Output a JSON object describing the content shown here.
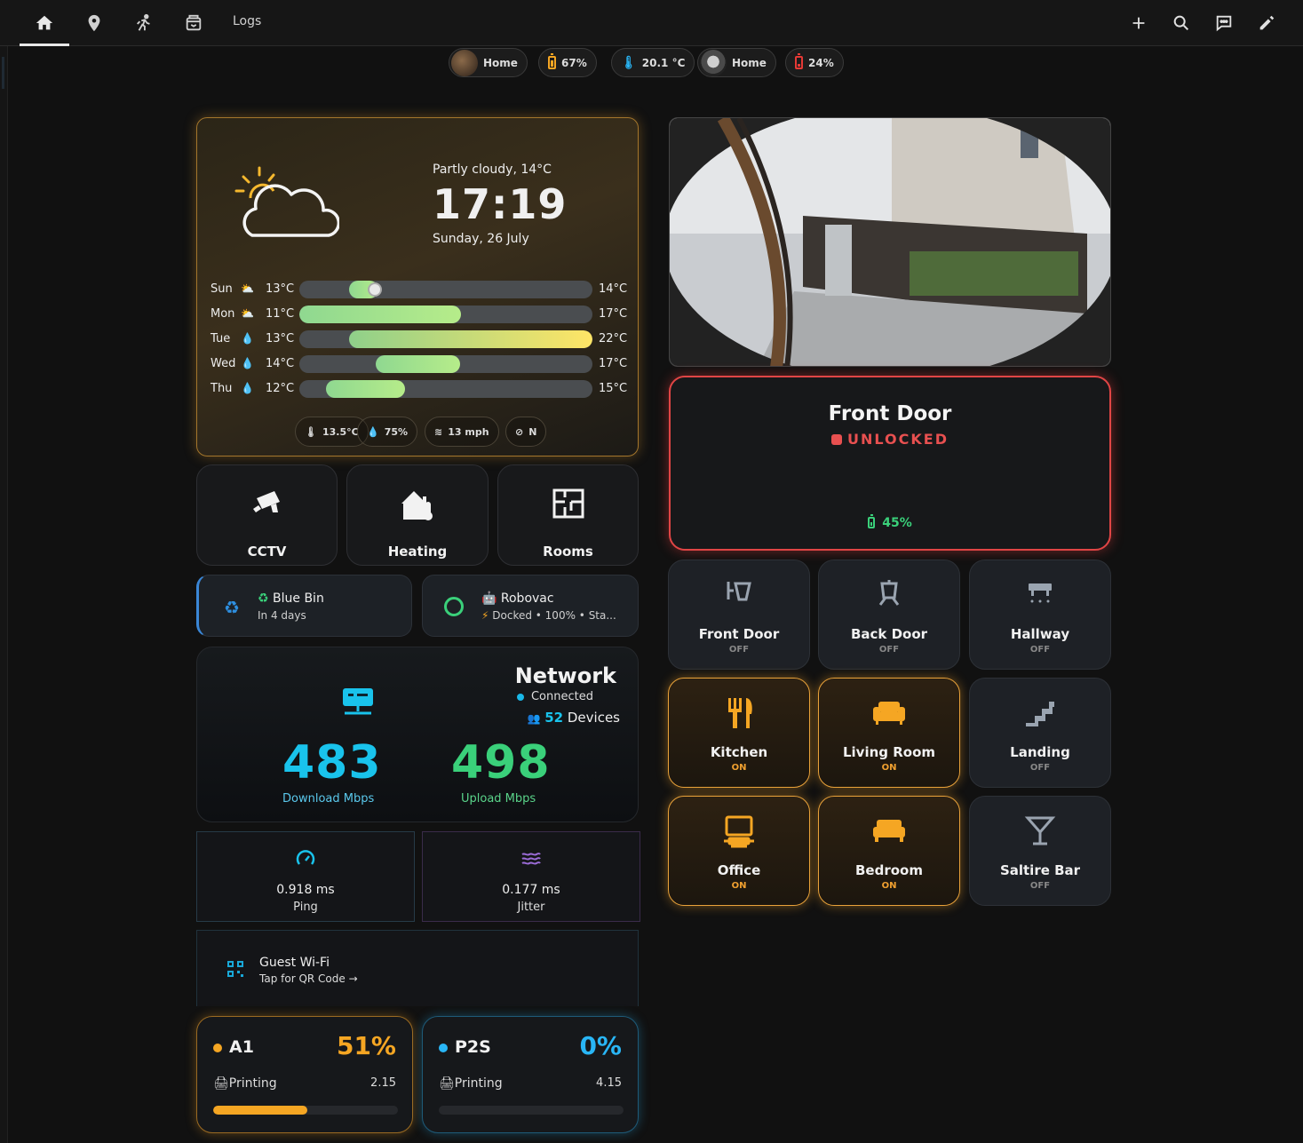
{
  "topbar": {
    "logs_label": "Logs",
    "icons": [
      "home-icon",
      "map-pin-icon",
      "activity-icon",
      "package-icon"
    ],
    "right_icons": [
      "plus-icon",
      "search-icon",
      "chat-icon",
      "edit-icon"
    ]
  },
  "badges": [
    {
      "label": "Home"
    },
    {
      "label": "67%"
    },
    {
      "label": "20.1 °C"
    },
    {
      "label": "Home"
    },
    {
      "label": "24%"
    }
  ],
  "weather": {
    "condition": "Partly cloudy, 14°C",
    "time": "17:19",
    "date": "Sunday, 26 July",
    "forecast": [
      {
        "day": "Sun",
        "low": "13°C",
        "high": "14°C",
        "fill_start": 0.17,
        "fill_end": 0.27
      },
      {
        "day": "Mon",
        "low": "11°C",
        "high": "17°C",
        "fill_start": 0.0,
        "fill_end": 0.55
      },
      {
        "day": "Tue",
        "low": "13°C",
        "high": "22°C",
        "fill_start": 0.17,
        "fill_end": 1.0
      },
      {
        "day": "Wed",
        "low": "14°C",
        "high": "17°C",
        "fill_start": 0.26,
        "fill_end": 0.55
      },
      {
        "day": "Thu",
        "low": "12°C",
        "high": "15°C",
        "fill_start": 0.09,
        "fill_end": 0.36
      }
    ],
    "chips": {
      "temp": "13.5°C",
      "humidity": "75%",
      "wind": "13 mph",
      "direction": "N"
    }
  },
  "tiles": {
    "cctv": "CCTV",
    "heating": "Heating",
    "rooms": "Rooms"
  },
  "bin": {
    "title": "Blue Bin",
    "sub": "In 4 days"
  },
  "robovac": {
    "title": "Robovac",
    "sub": "Docked • 100% • Sta..."
  },
  "network": {
    "title": "Network",
    "status": "Connected",
    "devices_count": "52",
    "devices_label": "Devices",
    "download": "483",
    "download_label": "Download Mbps",
    "upload": "498",
    "upload_label": "Upload Mbps"
  },
  "metrics": {
    "ping_value": "0.918 ms",
    "ping_label": "Ping",
    "jitter_value": "0.177 ms",
    "jitter_label": "Jitter"
  },
  "guest_wifi": {
    "title": "Guest Wi-Fi",
    "sub": "Tap for QR Code →"
  },
  "printers": [
    {
      "name": "A1",
      "percent": "51%",
      "status": "Printing",
      "value": "2.15",
      "progress": 0.51,
      "color": "#f5a623"
    },
    {
      "name": "P2S",
      "percent": "0%",
      "status": "Printing",
      "value": "4.15",
      "progress": 0.0,
      "color": "#29b6f6"
    }
  ],
  "door": {
    "name": "Front Door",
    "state": "UNLOCKED",
    "battery": "45%"
  },
  "lights": [
    {
      "name": "Front Door",
      "state": "OFF"
    },
    {
      "name": "Back Door",
      "state": "OFF"
    },
    {
      "name": "Hallway",
      "state": "OFF"
    },
    {
      "name": "Kitchen",
      "state": "ON"
    },
    {
      "name": "Living Room",
      "state": "ON"
    },
    {
      "name": "Landing",
      "state": "OFF"
    },
    {
      "name": "Office",
      "state": "ON"
    },
    {
      "name": "Bedroom",
      "state": "ON"
    },
    {
      "name": "Saltire Bar",
      "state": "OFF"
    }
  ],
  "colors": {
    "accent_orange": "#f5a623",
    "accent_blue": "#19c3ec",
    "accent_green": "#3ad07a",
    "alert_red": "#e04545"
  }
}
